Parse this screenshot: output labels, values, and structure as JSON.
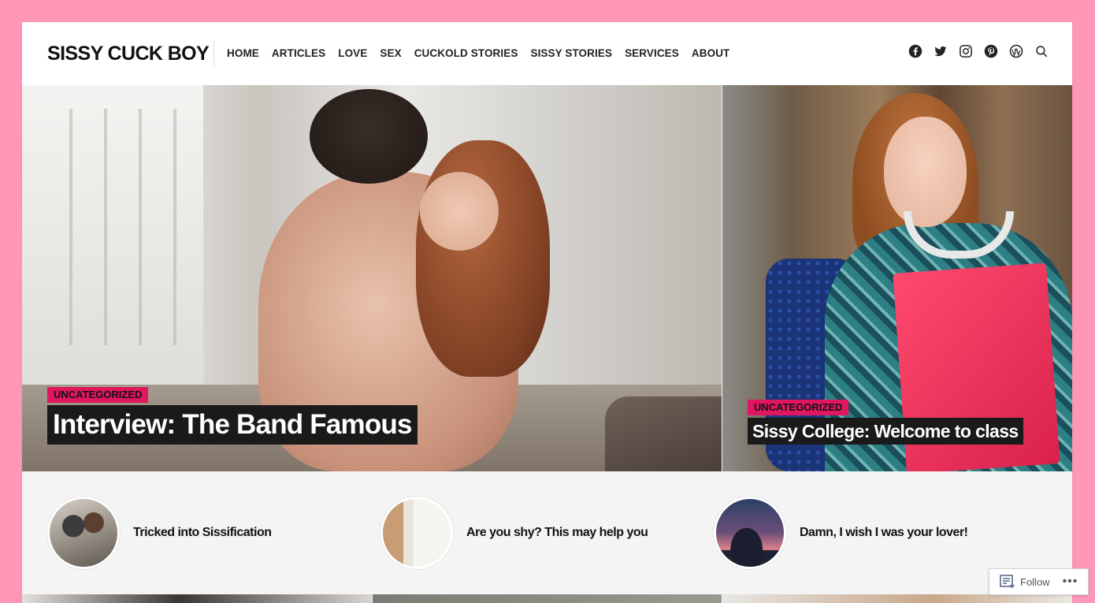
{
  "site": {
    "title": "SISSY CUCK BOY"
  },
  "nav": {
    "items": [
      "HOME",
      "ARTICLES",
      "LOVE",
      "SEX",
      "CUCKOLD STORIES",
      "SISSY STORIES",
      "SERVICES",
      "ABOUT"
    ]
  },
  "social": {
    "icons": [
      "facebook-icon",
      "twitter-icon",
      "instagram-icon",
      "pinterest-icon",
      "wordpress-icon",
      "search-icon"
    ]
  },
  "hero": {
    "left": {
      "category": "UNCATEGORIZED",
      "title": "Interview: The Band Famous"
    },
    "right": {
      "category": "UNCATEGORIZED",
      "title": "Sissy College: Welcome to class"
    }
  },
  "posts": [
    {
      "title": "Tricked into Sissification"
    },
    {
      "title": "Are you shy? This may help you"
    },
    {
      "title": "Damn, I wish I was your lover!"
    }
  ],
  "follow": {
    "label": "Follow",
    "more": "•••"
  },
  "colors": {
    "background": "#ff97b7",
    "accent": "#e0175f",
    "headline_bg": "#1a1a1a"
  }
}
